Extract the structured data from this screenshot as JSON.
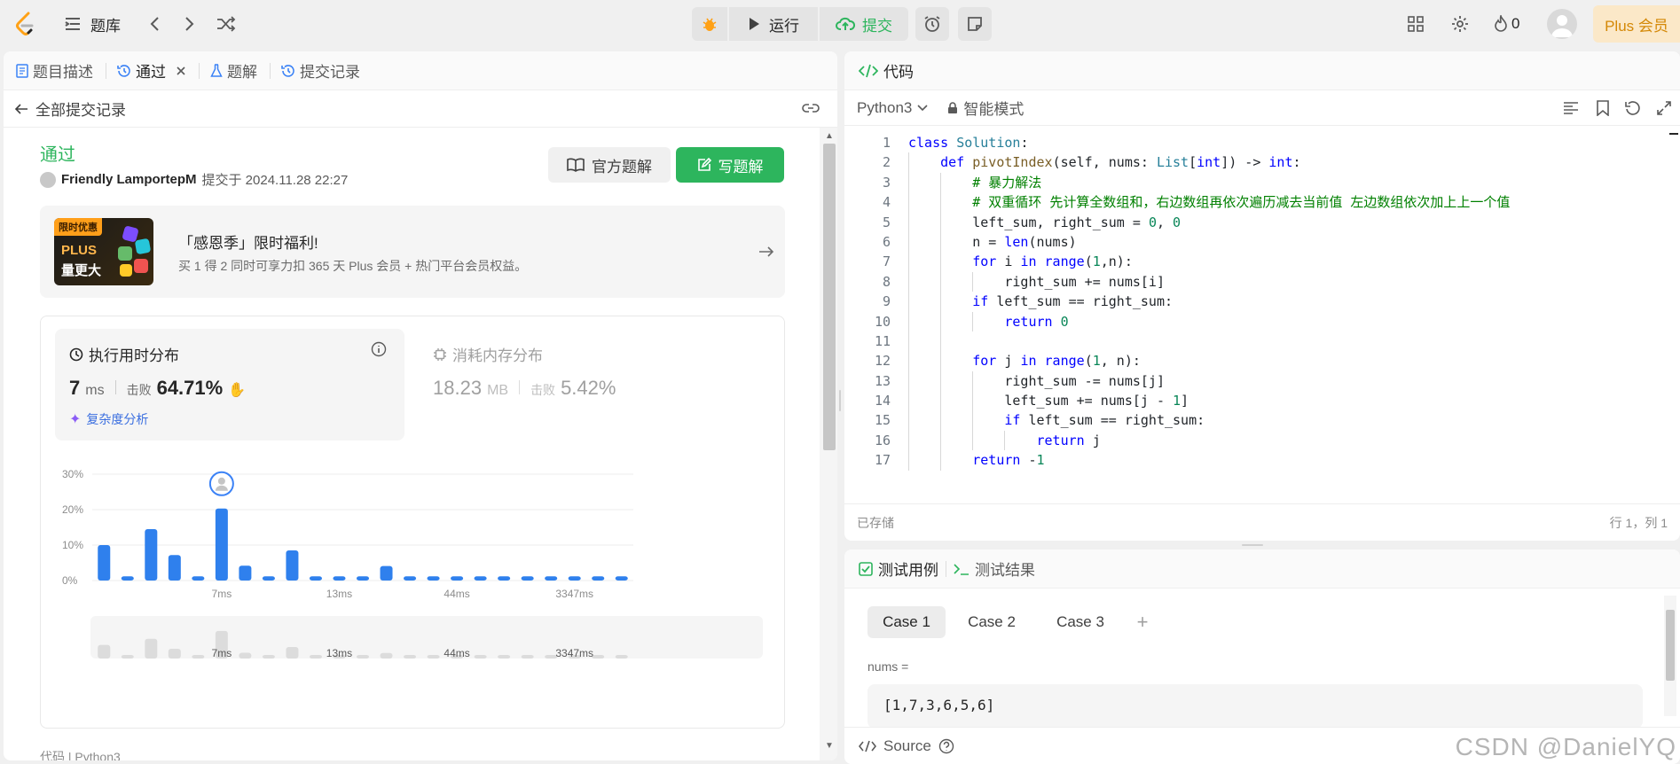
{
  "topbar": {
    "problem_list_label": "题库",
    "run_label": "运行",
    "submit_label": "提交",
    "streak_count": "0",
    "plus_label": "Plus 会员"
  },
  "left": {
    "tabs": [
      {
        "label": "题目描述"
      },
      {
        "label": "通过"
      },
      {
        "label": "题解"
      },
      {
        "label": "提交记录"
      }
    ],
    "back_label": "全部提交记录",
    "status": "通过",
    "author": "Friendly LamportepM",
    "submitted_at": "提交于 2024.11.28 22:27",
    "official_solution_label": "官方题解",
    "write_solution_label": "写题解",
    "promo": {
      "badge": "限时优惠",
      "img_line1": "PLUS",
      "img_line2": "量更大",
      "title": "「感恩季」限时福利!",
      "desc": "买 1 得 2 同时可享力扣 365 天 Plus 会员 + 热门平台会员权益。"
    },
    "runtime": {
      "title": "执行用时分布",
      "value": "7",
      "unit": "ms",
      "beats_label": "击败",
      "beats": "64.71%",
      "analysis_label": "复杂度分析"
    },
    "memory": {
      "title": "消耗内存分布",
      "value": "18.23",
      "unit": "MB",
      "beats_label": "击败",
      "beats": "5.42%"
    },
    "footer_text": "代码 | Python3"
  },
  "chart_data": {
    "type": "bar",
    "ylim": [
      0,
      30
    ],
    "yticks": [
      "30%",
      "20%",
      "10%",
      "0%"
    ],
    "xtick_labels": [
      "7ms",
      "13ms",
      "44ms",
      "3347ms"
    ],
    "values": [
      10,
      1.2,
      14.5,
      7.2,
      1.2,
      20.3,
      4.2,
      1.2,
      8.5,
      1.2,
      1.2,
      1.2,
      4.1,
      1.2,
      1.2,
      1.2,
      1.2,
      1.2,
      1.2,
      1.2,
      1.2,
      1.2,
      1.2
    ],
    "highlight_index": 5,
    "bar_color": "#2f80ed"
  },
  "right": {
    "code_title": "代码",
    "language": "Python3",
    "mode_label": "智能模式",
    "saved_label": "已存储",
    "cursor_pos": "行 1，列 1",
    "code_lines": [
      "class Solution:",
      "    def pivotIndex(self, nums: List[int]) -> int:",
      "        # 暴力解法",
      "        # 双重循环 先计算全数组和，右边数组再依次遍历减去当前值 左边数组依次加上上一个值",
      "        left_sum, right_sum = 0, 0",
      "        n = len(nums)",
      "        for i in range(1,n):",
      "            right_sum += nums[i]",
      "        if left_sum == right_sum:",
      "            return 0",
      "",
      "        for j in range(1, n):",
      "            right_sum -= nums[j]",
      "            left_sum += nums[j - 1]",
      "            if left_sum == right_sum:",
      "                return j",
      "        return -1"
    ],
    "test_tabs": {
      "cases_label": "测试用例",
      "result_label": "测试结果"
    },
    "cases": [
      "Case 1",
      "Case 2",
      "Case 3"
    ],
    "input_label": "nums =",
    "input_value": "[1,7,3,6,5,6]",
    "source_label": "Source",
    "watermark": "CSDN @DanielYQ"
  }
}
